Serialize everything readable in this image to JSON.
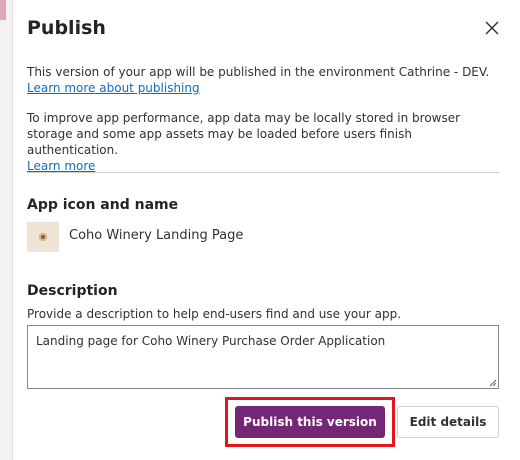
{
  "dialog": {
    "title": "Publish",
    "close_icon": "close-icon"
  },
  "environment_notice": {
    "text": "This version of your app will be published in the environment Cathrine - DEV.",
    "link": "Learn more about publishing"
  },
  "performance_notice": {
    "text": "To improve app performance, app data may be locally stored in browser storage and some app assets may be loaded before users finish authentication.",
    "link": "Learn more"
  },
  "app_identity": {
    "label": "App icon and name",
    "icon": "app-icon",
    "name": "Coho Winery Landing Page"
  },
  "description": {
    "label": "Description",
    "help_text": "Provide a description to help end-users find and use your app.",
    "value": "Landing page for Coho Winery Purchase Order Application"
  },
  "actions": {
    "publish_label": "Publish this version",
    "edit_label": "Edit details"
  },
  "colors": {
    "primary": "#742774",
    "link": "#0f6cbd",
    "highlight": "#e8141c"
  }
}
